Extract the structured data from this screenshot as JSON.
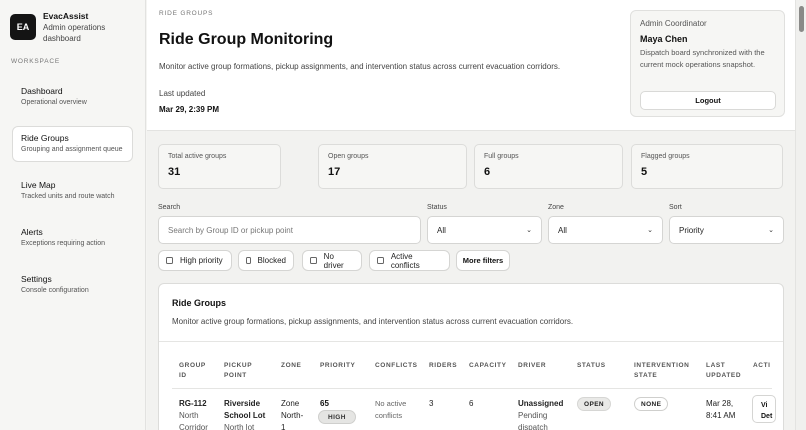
{
  "brand": {
    "logo": "EA",
    "name": "EvacAssist",
    "subtitle": "Admin operations dashboard"
  },
  "sidebar": {
    "section": "WORKSPACE",
    "items": [
      {
        "label": "Dashboard",
        "sub": "Operational overview"
      },
      {
        "label": "Ride Groups",
        "sub": "Grouping and assignment queue",
        "active": true
      },
      {
        "label": "Live Map",
        "sub": "Tracked units and route watch"
      },
      {
        "label": "Alerts",
        "sub": "Exceptions requiring action"
      },
      {
        "label": "Settings",
        "sub": "Console configuration"
      }
    ]
  },
  "header": {
    "eyebrow": "RIDE GROUPS",
    "title": "Ride Group Monitoring",
    "description": "Monitor active group formations, pickup assignments, and intervention status across current evacuation corridors.",
    "updated_label": "Last updated",
    "updated_value": "Mar 29, 2:39 PM"
  },
  "admin": {
    "role": "Admin Coordinator",
    "name": "Maya Chen",
    "note": "Dispatch board synchronized with the current mock operations snapshot.",
    "logout": "Logout"
  },
  "stats": [
    {
      "label": "Total active groups",
      "value": "31"
    },
    {
      "label": "Open groups",
      "value": "17"
    },
    {
      "label": "Full groups",
      "value": "6"
    },
    {
      "label": "Flagged groups",
      "value": "5"
    }
  ],
  "filters": {
    "search_label": "Search",
    "search_placeholder": "Search by Group ID or pickup point",
    "status_label": "Status",
    "status_value": "All",
    "zone_label": "Zone",
    "zone_value": "All",
    "sort_label": "Sort",
    "sort_value": "Priority",
    "chips": [
      "High priority",
      "Blocked",
      "No driver",
      "Active conflicts"
    ],
    "more": "More filters"
  },
  "table": {
    "title": "Ride Groups",
    "description": "Monitor active group formations, pickup assignments, and intervention status across current evacuation corridors.",
    "columns": [
      "GROUP ID",
      "PICKUP POINT",
      "ZONE",
      "PRIORITY",
      "CONFLICTS",
      "RIDERS",
      "CAPACITY",
      "DRIVER",
      "STATUS",
      "INTERVENTION STATE",
      "LAST UPDATED",
      "ACTIONS"
    ],
    "columns_display": {
      "group_id": [
        "GROUP",
        "ID"
      ],
      "pickup": [
        "PICKUP",
        "POINT"
      ],
      "zone": "ZONE",
      "priority": "PRIORITY",
      "conflicts": "CONFLICTS",
      "riders": "RIDERS",
      "capacity": "CAPACITY",
      "driver": "DRIVER",
      "status": "STATUS",
      "intervention": [
        "INTERVENTION",
        "STATE"
      ],
      "updated": [
        "LAST",
        "UPDATED"
      ],
      "actions": "ACTI"
    },
    "row": {
      "group_id": "RG-112",
      "group_sub": [
        "North",
        "Corridor"
      ],
      "pickup": [
        "Riverside",
        "School Lot"
      ],
      "pickup_sub": "North lot",
      "zone": [
        "Zone",
        "North-",
        "1"
      ],
      "priority": "65",
      "priority_badge": "HIGH",
      "conflicts": [
        "No active",
        "conflicts"
      ],
      "riders": "3",
      "capacity": "6",
      "driver": "Unassigned",
      "driver_sub": [
        "Pending",
        "dispatch"
      ],
      "status": "OPEN",
      "intervention": "NONE",
      "updated": [
        "Mar 28,",
        "8:41 AM"
      ],
      "action": [
        "Vi",
        "Det"
      ]
    }
  }
}
